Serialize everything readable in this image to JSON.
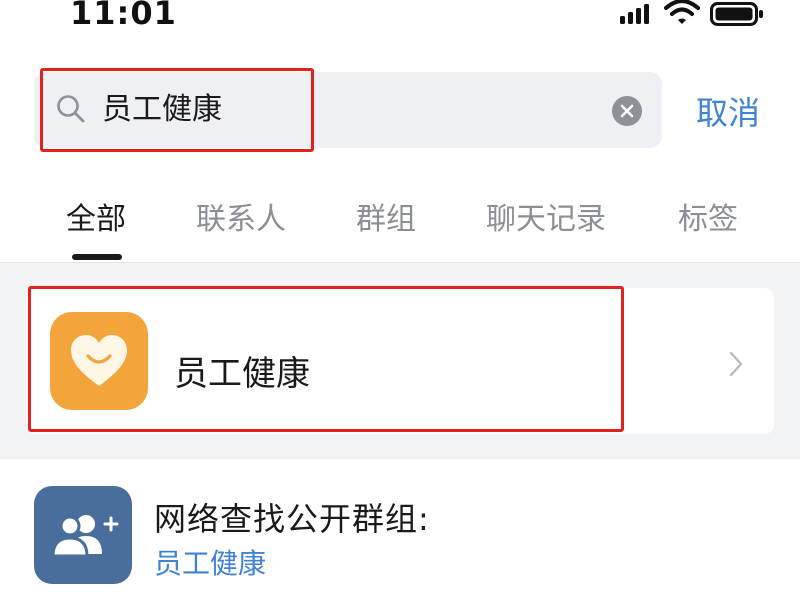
{
  "status_bar": {
    "time": "11:01"
  },
  "search": {
    "value": "员工健康",
    "cancel_label": "取消"
  },
  "tabs": [
    {
      "label": "全部",
      "active": true
    },
    {
      "label": "联系人",
      "active": false
    },
    {
      "label": "群组",
      "active": false
    },
    {
      "label": "聊天记录",
      "active": false
    },
    {
      "label": "标签",
      "active": false
    }
  ],
  "results": {
    "app_result": {
      "title": "员工健康",
      "icon": "heart-smile-icon"
    },
    "public_group_search": {
      "title": "网络查找公开群组:",
      "query": "员工健康",
      "icon": "add-group-icon"
    }
  },
  "colors": {
    "accent_blue": "#3f82d6",
    "app_icon_orange": "#f3a43a",
    "group_icon_blue": "#4a6e9c",
    "highlight_red": "#e0231c"
  }
}
